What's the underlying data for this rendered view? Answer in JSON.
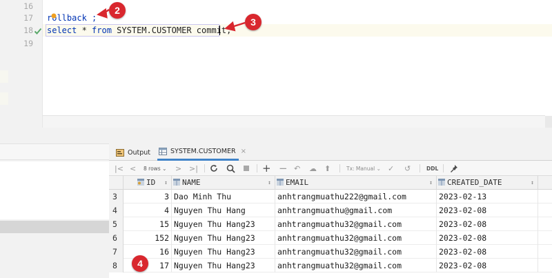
{
  "editor": {
    "line_numbers": [
      "16",
      "17",
      "18",
      "19"
    ],
    "lines": {
      "l17": {
        "text": "rollback ;"
      },
      "l18": {
        "kw_select": "select",
        "star": " * ",
        "kw_from": "from",
        "rest": " SYSTEM.CUSTOMER commit;"
      }
    },
    "executed_icon": "checkmark-icon"
  },
  "results": {
    "tabs": [
      {
        "label": "Output",
        "icon": "output-icon"
      },
      {
        "label": "SYSTEM.CUSTOMER",
        "icon": "table-icon",
        "close": "×"
      }
    ],
    "toolbar": {
      "rows_label": "8 rows ⌄",
      "tx_label": "Tx: Manual ⌄",
      "ddl_label": "DDL"
    },
    "columns": [
      "ID",
      "NAME",
      "EMAIL",
      "CREATED_DATE"
    ],
    "sort_glyph": "↕",
    "rows": [
      {
        "n": "3",
        "id": "3",
        "name": "Dao Minh Thu",
        "email": "anhtrangmuathu222@gmail.com",
        "date": "2023-02-13"
      },
      {
        "n": "4",
        "id": "4",
        "name": "Nguyen Thu Hang",
        "email": "anhtrangmuathu@gmail.com",
        "date": "2023-02-08"
      },
      {
        "n": "5",
        "id": "15",
        "name": "Nguyen Thu Hang23",
        "email": "anhtrangmuathu32@gmail.com",
        "date": "2023-02-08"
      },
      {
        "n": "6",
        "id": "152",
        "name": "Nguyen Thu Hang23",
        "email": "anhtrangmuathu32@gmail.com",
        "date": "2023-02-08"
      },
      {
        "n": "7",
        "id": "16",
        "name": "Nguyen Thu Hang23",
        "email": "anhtrangmuathu32@gmail.com",
        "date": "2023-02-08"
      },
      {
        "n": "8",
        "id": "17",
        "name": "Nguyen Thu Hang23",
        "email": "anhtrangmuathu32@gmail.com",
        "date": "2023-02-08"
      }
    ]
  },
  "callouts": [
    "2",
    "3",
    "4"
  ],
  "colors": {
    "callout": "#d9272e",
    "keyword": "#0033b3",
    "tab_underline": "#4083c9",
    "check": "#59a869"
  }
}
